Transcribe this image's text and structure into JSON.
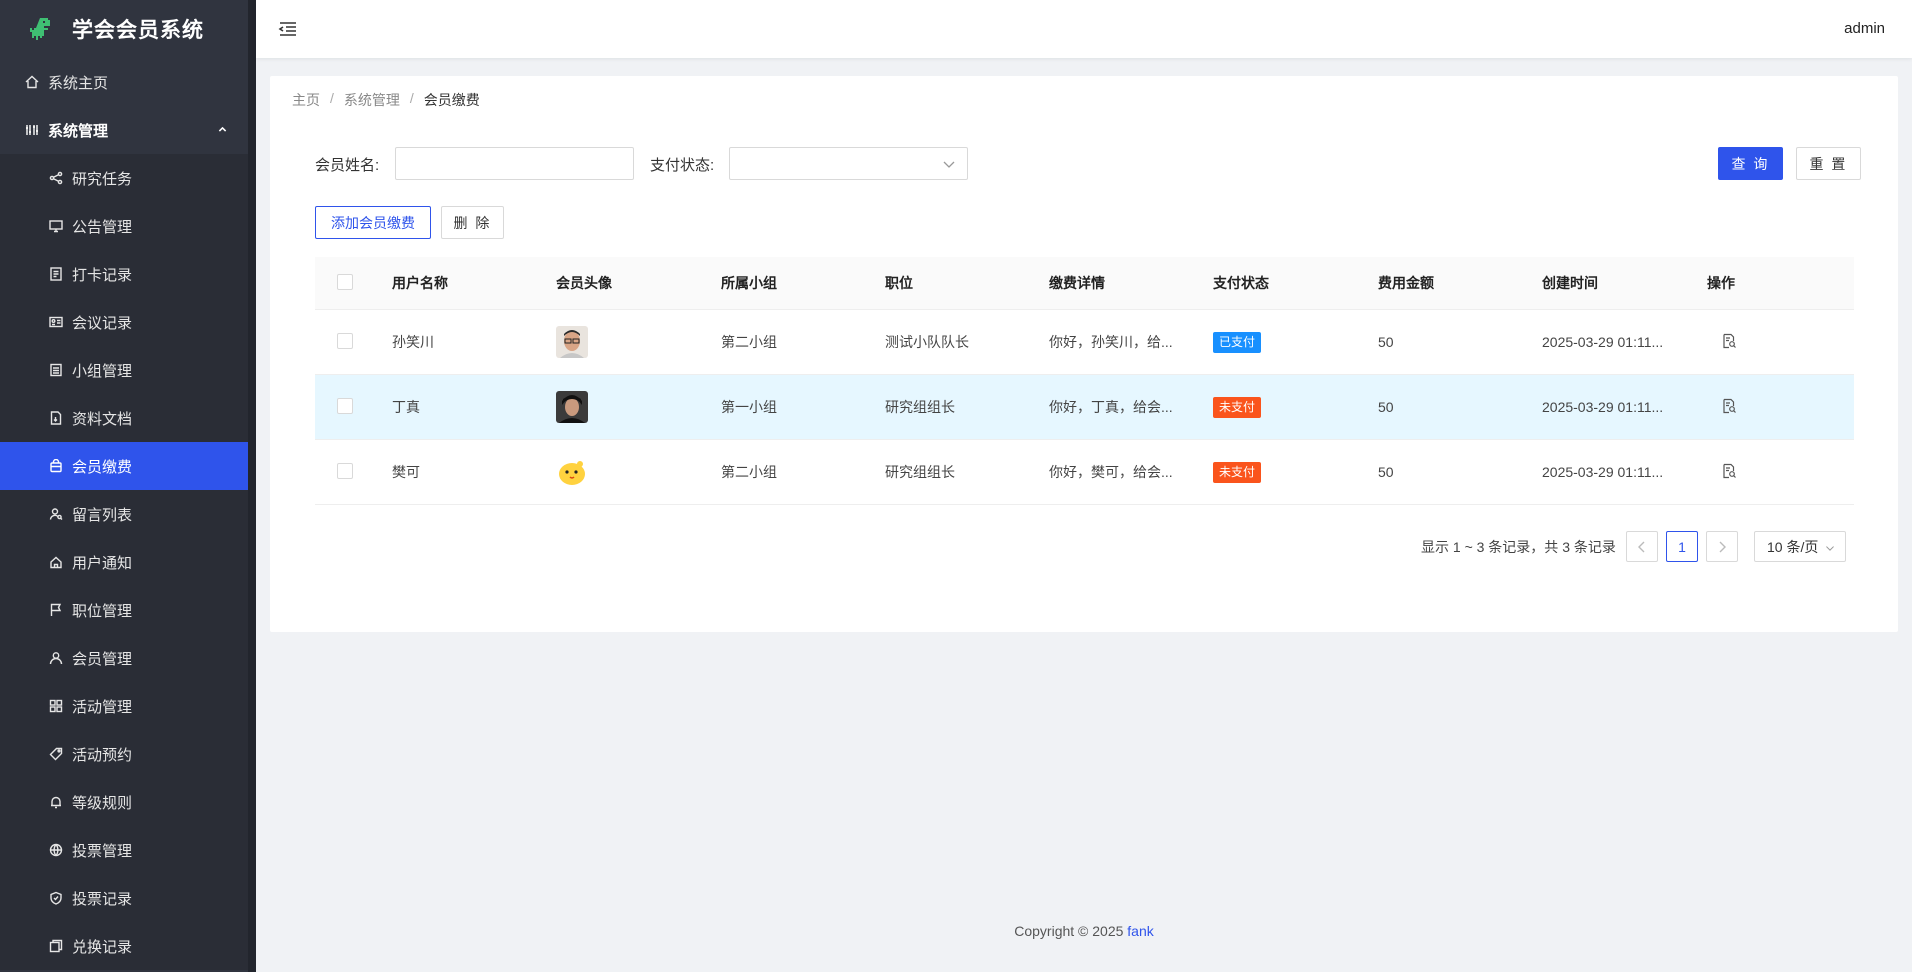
{
  "app": {
    "title": "学会会员系统",
    "user": "admin"
  },
  "sidebar": {
    "home": "系统主页",
    "group": "系统管理",
    "items": [
      {
        "label": "研究任务",
        "icon": "share-icon"
      },
      {
        "label": "公告管理",
        "icon": "monitor-icon"
      },
      {
        "label": "打卡记录",
        "icon": "receipt-icon"
      },
      {
        "label": "会议记录",
        "icon": "id-card-icon"
      },
      {
        "label": "小组管理",
        "icon": "list-icon"
      },
      {
        "label": "资料文档",
        "icon": "file-icon"
      },
      {
        "label": "会员缴费",
        "icon": "bag-icon",
        "active": true
      },
      {
        "label": "留言列表",
        "icon": "user-search-icon"
      },
      {
        "label": "用户通知",
        "icon": "house-icon"
      },
      {
        "label": "职位管理",
        "icon": "flag-icon"
      },
      {
        "label": "会员管理",
        "icon": "user-icon"
      },
      {
        "label": "活动管理",
        "icon": "grid-icon"
      },
      {
        "label": "活动预约",
        "icon": "tag-icon"
      },
      {
        "label": "等级规则",
        "icon": "bell-icon"
      },
      {
        "label": "投票管理",
        "icon": "globe-icon"
      },
      {
        "label": "投票记录",
        "icon": "shield-icon"
      },
      {
        "label": "兑换记录",
        "icon": "copy-icon"
      }
    ]
  },
  "breadcrumb": [
    "主页",
    "系统管理",
    "会员缴费"
  ],
  "filters": {
    "name_label": "会员姓名:",
    "name_value": "",
    "status_label": "支付状态:",
    "status_value": "",
    "query": "查 询",
    "reset": "重 置"
  },
  "actions": {
    "add": "添加会员缴费",
    "delete": "删 除"
  },
  "table": {
    "columns": [
      "用户名称",
      "会员头像",
      "所属小组",
      "职位",
      "缴费详情",
      "支付状态",
      "费用金额",
      "创建时间",
      "操作"
    ],
    "rows": [
      {
        "name": "孙笑川",
        "group": "第二小组",
        "position": "测试小队队长",
        "detail": "你好，孙笑川，给...",
        "status": "已支付",
        "amount": "50",
        "created": "2025-03-29 01:11..."
      },
      {
        "name": "丁真",
        "group": "第一小组",
        "position": "研究组组长",
        "detail": "你好，丁真，给会...",
        "status": "未支付",
        "amount": "50",
        "created": "2025-03-29 01:11..."
      },
      {
        "name": "樊可",
        "group": "第二小组",
        "position": "研究组组长",
        "detail": "你好，樊可，给会...",
        "status": "未支付",
        "amount": "50",
        "created": "2025-03-29 01:11..."
      }
    ]
  },
  "pagination": {
    "summary": "显示 1 ~ 3 条记录，共 3 条记录",
    "current": "1",
    "page_size": "10 条/页"
  },
  "footer": {
    "text": "Copyright © 2025",
    "link": "fank"
  },
  "colors": {
    "accent": "#2f54eb",
    "sidebar": "#30343f",
    "paid": "#1890ff",
    "unpaid": "#fa541c"
  }
}
